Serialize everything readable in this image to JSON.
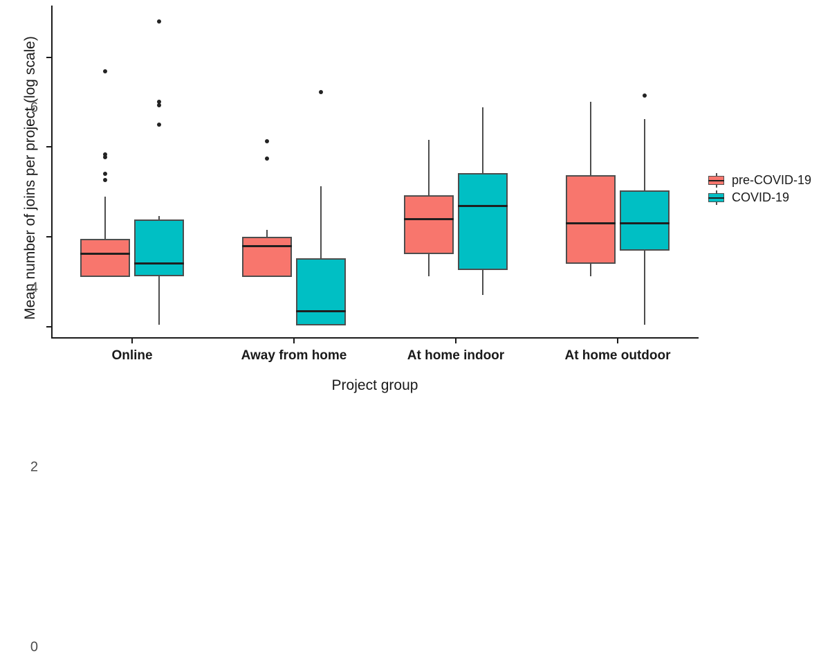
{
  "chart_data": {
    "type": "box",
    "title": "",
    "xlabel": "Project group",
    "ylabel": "Mean number of joins per project (log scale)",
    "categories": [
      "Online",
      "Away from home",
      "At home indoor",
      "At home outdoor"
    ],
    "ylim": [
      -0.25,
      7.15
    ],
    "yticks": [
      0,
      2,
      4,
      6
    ],
    "ytick_labels": [
      "0",
      "2",
      "4",
      "6"
    ],
    "grid": false,
    "legend_position": "right",
    "colors": {
      "pre-COVID-19": "#F8766D",
      "COVID-19": "#00BFC4",
      "outline": "#4d4d4d",
      "median": "#1f1f1f",
      "outlier": "#232323",
      "axis": "#1a1a1a",
      "tick_text": "#4d4d4d"
    },
    "legend": [
      {
        "name": "pre-COVID-19",
        "color": "#F8766D"
      },
      {
        "name": "COVID-19",
        "color": "#00BFC4"
      }
    ],
    "series": [
      {
        "name": "pre-COVID-19",
        "color": "#F8766D",
        "boxes": [
          {
            "category": "Online",
            "whisker_low": 1.1,
            "q1": 1.1,
            "median": 1.62,
            "q3": 1.95,
            "whisker_high": 2.89,
            "outliers": [
              5.68,
              3.84,
              3.78,
              3.4,
              3.27
            ]
          },
          {
            "category": "Away from home",
            "whisker_low": 1.1,
            "q1": 1.1,
            "median": 1.8,
            "q3": 2.0,
            "whisker_high": 2.16,
            "outliers": [
              4.13,
              3.75
            ]
          },
          {
            "category": "At home indoor",
            "whisker_low": 1.12,
            "q1": 1.62,
            "median": 2.4,
            "q3": 2.93,
            "whisker_high": 4.16,
            "outliers": []
          },
          {
            "category": "At home outdoor",
            "whisker_low": 1.12,
            "q1": 1.4,
            "median": 2.3,
            "q3": 3.38,
            "whisker_high": 5.0,
            "outliers": []
          }
        ]
      },
      {
        "name": "COVID-19",
        "color": "#00BFC4",
        "boxes": [
          {
            "category": "Online",
            "whisker_low": 0.05,
            "q1": 1.12,
            "median": 1.4,
            "q3": 2.38,
            "whisker_high": 2.47,
            "outliers": [
              6.79,
              5.01,
              4.93,
              4.5
            ]
          },
          {
            "category": "Away from home",
            "whisker_low": 0.02,
            "q1": 0.02,
            "median": 0.35,
            "q3": 1.53,
            "whisker_high": 3.12,
            "outliers": [
              5.22
            ]
          },
          {
            "category": "At home indoor",
            "whisker_low": 0.71,
            "q1": 1.26,
            "median": 2.68,
            "q3": 3.42,
            "whisker_high": 4.88,
            "outliers": []
          },
          {
            "category": "At home outdoor",
            "whisker_low": 0.04,
            "q1": 1.7,
            "median": 2.3,
            "q3": 3.03,
            "whisker_high": 4.62,
            "outliers": [
              5.15
            ]
          }
        ]
      }
    ]
  }
}
